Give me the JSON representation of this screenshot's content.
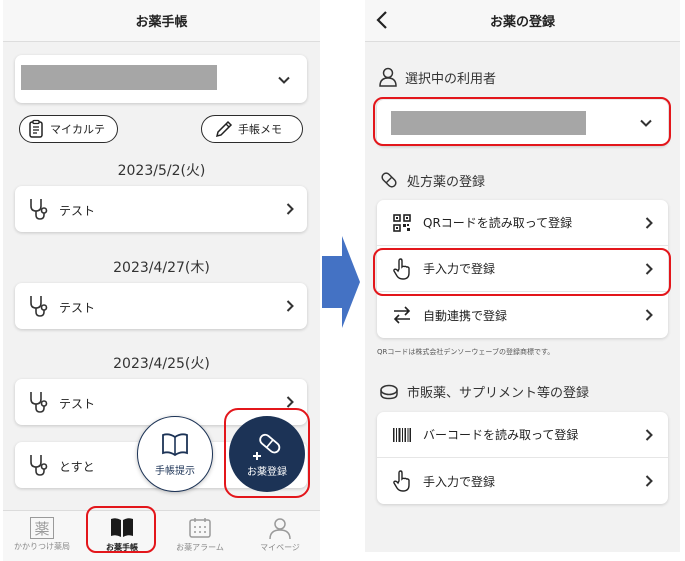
{
  "left": {
    "header_title": "お薬手帳",
    "pill_karte": "マイカルテ",
    "pill_memo": "手帳メモ",
    "dates": [
      "2023/5/2(火)",
      "2023/4/27(木)",
      "2023/4/25(火)"
    ],
    "records": [
      "テスト",
      "テスト",
      "テスト",
      "とすと"
    ],
    "fab_notebook": "手帳提示",
    "fab_register": "お薬登録",
    "tabs": [
      "かかりつけ薬局",
      "お薬手帳",
      "お薬アラーム",
      "マイページ"
    ],
    "tab_pharmacy_glyph": "薬"
  },
  "right": {
    "header_title": "お薬の登録",
    "section_user": "選択中の利用者",
    "section_prescription": "処方薬の登録",
    "prescription_items": [
      "QRコードを読み取って登録",
      "手入力で登録",
      "自動連携で登録"
    ],
    "qr_note": "QRコードは株式会社デンソーウェーブの登録商標です。",
    "section_otc": "市販薬、サプリメント等の登録",
    "otc_items": [
      "バーコードを読み取って登録",
      "手入力で登録"
    ]
  },
  "colors": {
    "highlight": "#e3161b",
    "fab_dark": "#1c3356",
    "arrow": "#4472c4",
    "redacted": "#a6a6a6"
  },
  "icons": [
    "chevron-down-icon",
    "chevron-right-icon",
    "chevron-left-icon",
    "stethoscope-icon",
    "clipboard-icon",
    "pen-icon",
    "book-icon",
    "pill-icon",
    "person-icon",
    "qr-code-icon",
    "hand-pointer-icon",
    "swap-arrows-icon",
    "coin-icon",
    "barcode-icon",
    "calendar-icon"
  ]
}
